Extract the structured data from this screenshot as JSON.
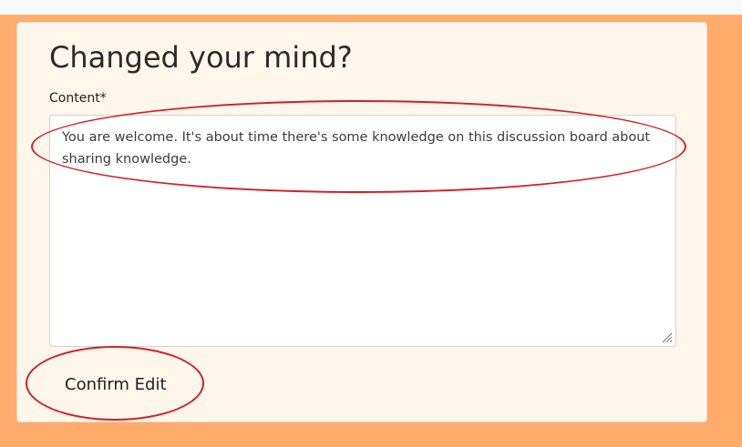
{
  "form": {
    "title": "Changed your mind?",
    "content_label": "Content*",
    "content_value": "You are welcome. It's about time there's some knowledge on this discussion board about sharing knowledge.",
    "confirm_label": "Confirm Edit"
  },
  "colors": {
    "page_background": "#ffab6b",
    "card_background": "#fff6ec",
    "annotation": "#d42020"
  },
  "icons": {
    "textarea_resize": "resize-grip-icon"
  }
}
